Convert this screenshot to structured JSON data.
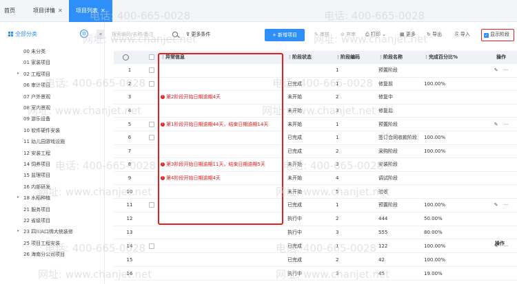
{
  "tabs": [
    {
      "label": "首页",
      "closable": false
    },
    {
      "label": "项目详情",
      "closable": true
    },
    {
      "label": "项目列表",
      "closable": true,
      "active": true
    }
  ],
  "sidebar": {
    "title": "全部分类",
    "items": [
      {
        "label": "00 未分类",
        "caret": false
      },
      {
        "label": "01 家装项目",
        "caret": false
      },
      {
        "label": "02 工程项目",
        "caret": true
      },
      {
        "label": "06 审计项目",
        "caret": false
      },
      {
        "label": "07 户外景观",
        "caret": false
      },
      {
        "label": "08 室内景观",
        "caret": false
      },
      {
        "label": "09 游乐设备",
        "caret": false
      },
      {
        "label": "10 软件硬件安装",
        "caret": false
      },
      {
        "label": "11 幼儿园游戏设施",
        "caret": false
      },
      {
        "label": "12 安装工程",
        "caret": false
      },
      {
        "label": "14 饲养项目",
        "caret": false
      },
      {
        "label": "15 监理项目",
        "caret": false
      },
      {
        "label": "16 内部研发",
        "caret": false
      },
      {
        "label": "18 水稻种植",
        "caret": true
      },
      {
        "label": "21 服务项目",
        "caret": false
      },
      {
        "label": "22 省级项目",
        "caret": false
      },
      {
        "label": "23 四川A口牌大统装修",
        "caret": true
      },
      {
        "label": "25 项目工程安装",
        "caret": false
      },
      {
        "label": "26 海南分公司项目",
        "caret": false
      }
    ]
  },
  "toolbar": {
    "search_placeholder": "搜索编码/名称/备注",
    "more_conditions": "更多条件",
    "add_project": "+ 新增项目",
    "review": "审核",
    "unreview": "弃审",
    "print": "打印",
    "more": "更多",
    "export": "导出",
    "import": "导入",
    "show_stage": "显示阶段"
  },
  "table": {
    "headers": [
      "异常信息",
      "阶段状态",
      "阶段编码",
      "阶段名称",
      "完成百分比%",
      "操作"
    ],
    "rows": [
      {
        "no": "1",
        "checkbox": true,
        "warn": "",
        "status": "",
        "code": "1",
        "name": "预置阶段",
        "pct": "",
        "edit": true,
        "more": true
      },
      {
        "no": "2",
        "checkbox": true,
        "warn": "",
        "status": "已完成",
        "code": "1",
        "name": "修复前",
        "pct": "100.00%",
        "edit": false,
        "more": false
      },
      {
        "no": "3",
        "checkbox": false,
        "warn": "第2阶段开始日期逾期4天",
        "status": "未开始",
        "code": "2",
        "name": "修复中",
        "pct": "",
        "edit": false,
        "more": false
      },
      {
        "no": "4",
        "checkbox": false,
        "warn": "",
        "status": "未开始",
        "code": "3",
        "name": "修复后",
        "pct": "",
        "edit": false,
        "more": false
      },
      {
        "no": "5",
        "checkbox": true,
        "warn": "第1阶段开始日期逾期44天，结束日期逾期14天",
        "status": "未开始",
        "code": "1",
        "name": "预置阶段",
        "pct": "",
        "edit": true,
        "more": true
      },
      {
        "no": "6",
        "checkbox": true,
        "warn": "",
        "status": "已完成",
        "code": "1",
        "name": "签订合同收款阶段",
        "pct": "100.00%",
        "edit": false,
        "more": false
      },
      {
        "no": "7",
        "checkbox": false,
        "warn": "",
        "status": "已完成",
        "code": "2",
        "name": "采购阶段",
        "pct": "100.00%",
        "edit": false,
        "more": false
      },
      {
        "no": "8",
        "checkbox": false,
        "warn": "第3阶段开始日期逾期11天，结束日期逾期5天",
        "status": "未开始",
        "code": "3",
        "name": "安装阶段",
        "pct": "",
        "edit": false,
        "more": false
      },
      {
        "no": "9",
        "checkbox": false,
        "warn": "第4阶段开始日期逾期4天",
        "status": "未开始",
        "code": "4",
        "name": "调试阶段",
        "pct": "",
        "edit": false,
        "more": false
      },
      {
        "no": "10",
        "checkbox": false,
        "warn": "",
        "status": "未开始",
        "code": "5",
        "name": "验收",
        "pct": "",
        "edit": false,
        "more": false
      },
      {
        "no": "11",
        "checkbox": true,
        "warn": "",
        "status": "已完成",
        "code": "1",
        "name": "预置阶段",
        "pct": "100.00%",
        "edit": true,
        "more": true
      },
      {
        "no": "12",
        "checkbox": false,
        "warn": "",
        "status": "执行中",
        "code": "2",
        "name": "444",
        "pct": "50.00%",
        "edit": false,
        "more": false
      },
      {
        "no": "13",
        "checkbox": false,
        "warn": "",
        "status": "执行中",
        "code": "3",
        "name": "555",
        "pct": "80.00%",
        "edit": false,
        "more": false
      },
      {
        "no": "14",
        "checkbox": true,
        "warn": "",
        "status": "已完成",
        "code": "1",
        "name": "122",
        "pct": "100.00%",
        "edit": true,
        "more": true
      },
      {
        "no": "15",
        "checkbox": false,
        "warn": "",
        "status": "已完成",
        "code": "2",
        "name": "42",
        "pct": "100.00%",
        "edit": false,
        "more": false
      },
      {
        "no": "16",
        "checkbox": false,
        "warn": "",
        "status": "执行中",
        "code": "3",
        "name": "45",
        "pct": "19.00%",
        "edit": false,
        "more": false
      }
    ],
    "second_header_action": "操作"
  },
  "watermark": {
    "phone": "电话: 400-665-0028",
    "site": "网址: www.chanjet.net"
  }
}
